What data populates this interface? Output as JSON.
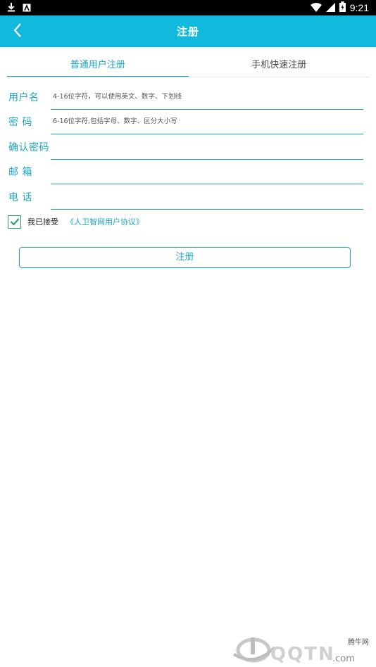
{
  "status_bar": {
    "time": "9:21"
  },
  "header": {
    "title": "注册"
  },
  "tabs": [
    {
      "label": "普通用户注册",
      "active": true
    },
    {
      "label": "手机快速注册",
      "active": false
    }
  ],
  "form": {
    "username": {
      "label": "用户名",
      "placeholder": "4-16位字符，可以使用英文、数字、下划线",
      "value": ""
    },
    "password": {
      "label": "密 码",
      "placeholder": "6-16位字符,包括字母、数字、区分大小写",
      "value": ""
    },
    "confirm_password": {
      "label": "确认密码",
      "placeholder": "",
      "value": ""
    },
    "email": {
      "label": "邮 箱",
      "placeholder": "",
      "value": ""
    },
    "phone": {
      "label": "电 话",
      "placeholder": "",
      "value": ""
    }
  },
  "agreement": {
    "checked": true,
    "text": "我已接受",
    "link": "《人卫智网用户协议》"
  },
  "submit": {
    "label": "注册"
  },
  "watermark": {
    "brand": "腾牛网",
    "site": "QQTN.com"
  },
  "colors": {
    "accent": "#12b9de",
    "text_accent": "#1aa5c7",
    "check": "#2f9e6f"
  }
}
